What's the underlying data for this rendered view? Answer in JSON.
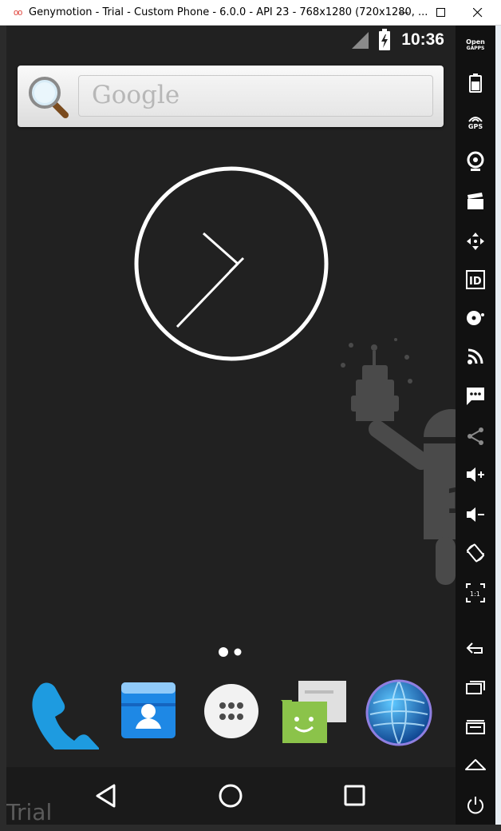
{
  "window": {
    "title": "Genymotion - Trial - Custom Phone - 6.0.0 - API 23 - 768x1280 (720x1280, ...",
    "logo": "oo",
    "minimize_icon": "minimize-icon",
    "maximize_icon": "maximize-icon",
    "close_icon": "close-icon"
  },
  "status_bar": {
    "time": "10:36",
    "icons": [
      "signal-icon",
      "battery-charging-icon"
    ]
  },
  "search_widget": {
    "placeholder": "Google",
    "icon": "magnifier-icon"
  },
  "clock_widget": {
    "type": "analog",
    "hour_hand_angle_deg": 220,
    "minute_hand_angle_deg": 315
  },
  "home_page_indicator": {
    "pages": 2,
    "current": 1
  },
  "dock": [
    {
      "name": "phone",
      "icon": "phone-icon"
    },
    {
      "name": "contacts",
      "icon": "contacts-icon"
    },
    {
      "name": "apps",
      "icon": "app-drawer-icon"
    },
    {
      "name": "messenger",
      "icon": "messenger-icon"
    },
    {
      "name": "browser",
      "icon": "globe-icon"
    }
  ],
  "nav_bar": {
    "buttons": [
      "back-icon",
      "home-icon",
      "recents-icon"
    ]
  },
  "watermark": "Trial",
  "side_toolbar": {
    "open_gapps_line1": "Open",
    "open_gapps_line2": "GAPPS",
    "gps_label": "GPS",
    "id_label": "ID",
    "ratio_label": "1:1",
    "tools": [
      "open-gapps",
      "battery-icon",
      "gps-icon",
      "webcam-icon",
      "screencast-icon",
      "remote-control-icon",
      "identifiers-icon",
      "disk-icon",
      "network-icon",
      "sms-icon",
      "share-icon",
      "volume-up-icon",
      "volume-down-icon",
      "rotate-icon",
      "pixel-perfect-icon",
      "back-icon",
      "recents-icon",
      "menu-icon",
      "home-icon",
      "power-icon"
    ]
  },
  "colors": {
    "phone_bg": "#212121",
    "toolbar_bg": "#111111",
    "accent_blue": "#1e9be0",
    "green": "#8bc34a"
  }
}
